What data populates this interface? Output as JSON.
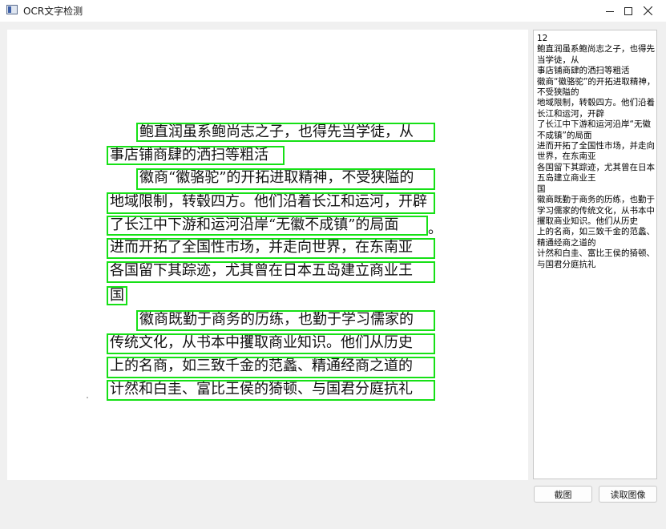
{
  "window": {
    "title": "OCR文字检测"
  },
  "image_lines": [
    "鲍直润虽系鲍尚志之子，也得先当学徒，从",
    "事店铺商肆的洒扫等粗活",
    "徽商“徽骆驼”的开拓进取精神，不受狭隘的",
    "地域限制，转毂四方。他们沿着长江和运河，开辟",
    "了长江中下游和运河沿岸“无徽不成镇”的局面",
    "进而开拓了全国性市场，并走向世界，在东南亚",
    "各国留下其踪迹，尤其曾在日本五岛建立商业王",
    "国",
    "徽商既勤于商务的历练，也勤于学习儒家的",
    "传统文化，从书本中攫取商业知识。他们从历史",
    "上的名商，如三致千金的范蠡、精通经商之道的",
    "计然和白圭、富比王侯的猗顿、与国君分庭抗礼"
  ],
  "image_trailing": "。",
  "ocr_result": "12\n鲍直润虽系鲍尚志之子，也得先当学徒，从\n事店铺商肆的洒扫等粗活\n徽商“徽骆驼”的开拓进取精神，不受狭隘的\n地域限制，转毂四方。他们沿着长江和运河，开辟\n了长江中下游和运河沿岸“无徽不成镇”的局面\n进而开拓了全国性市场，并走向世界，在东南亚\n各国留下其踪迹，尤其曾在日本五岛建立商业王\n国\n徽商既勤于商务的历练，也勤于学习儒家的传统文化，从书本中攫取商业知识。他们从历史\n上的名商，如三致千金的范蠡、精通经商之道的\n计然和白圭、富比王侯的猗顿、与国君分庭抗礼",
  "buttons": {
    "screenshot": "截图",
    "read_image": "读取图像"
  },
  "colors": {
    "detection_box": "#16e016"
  }
}
